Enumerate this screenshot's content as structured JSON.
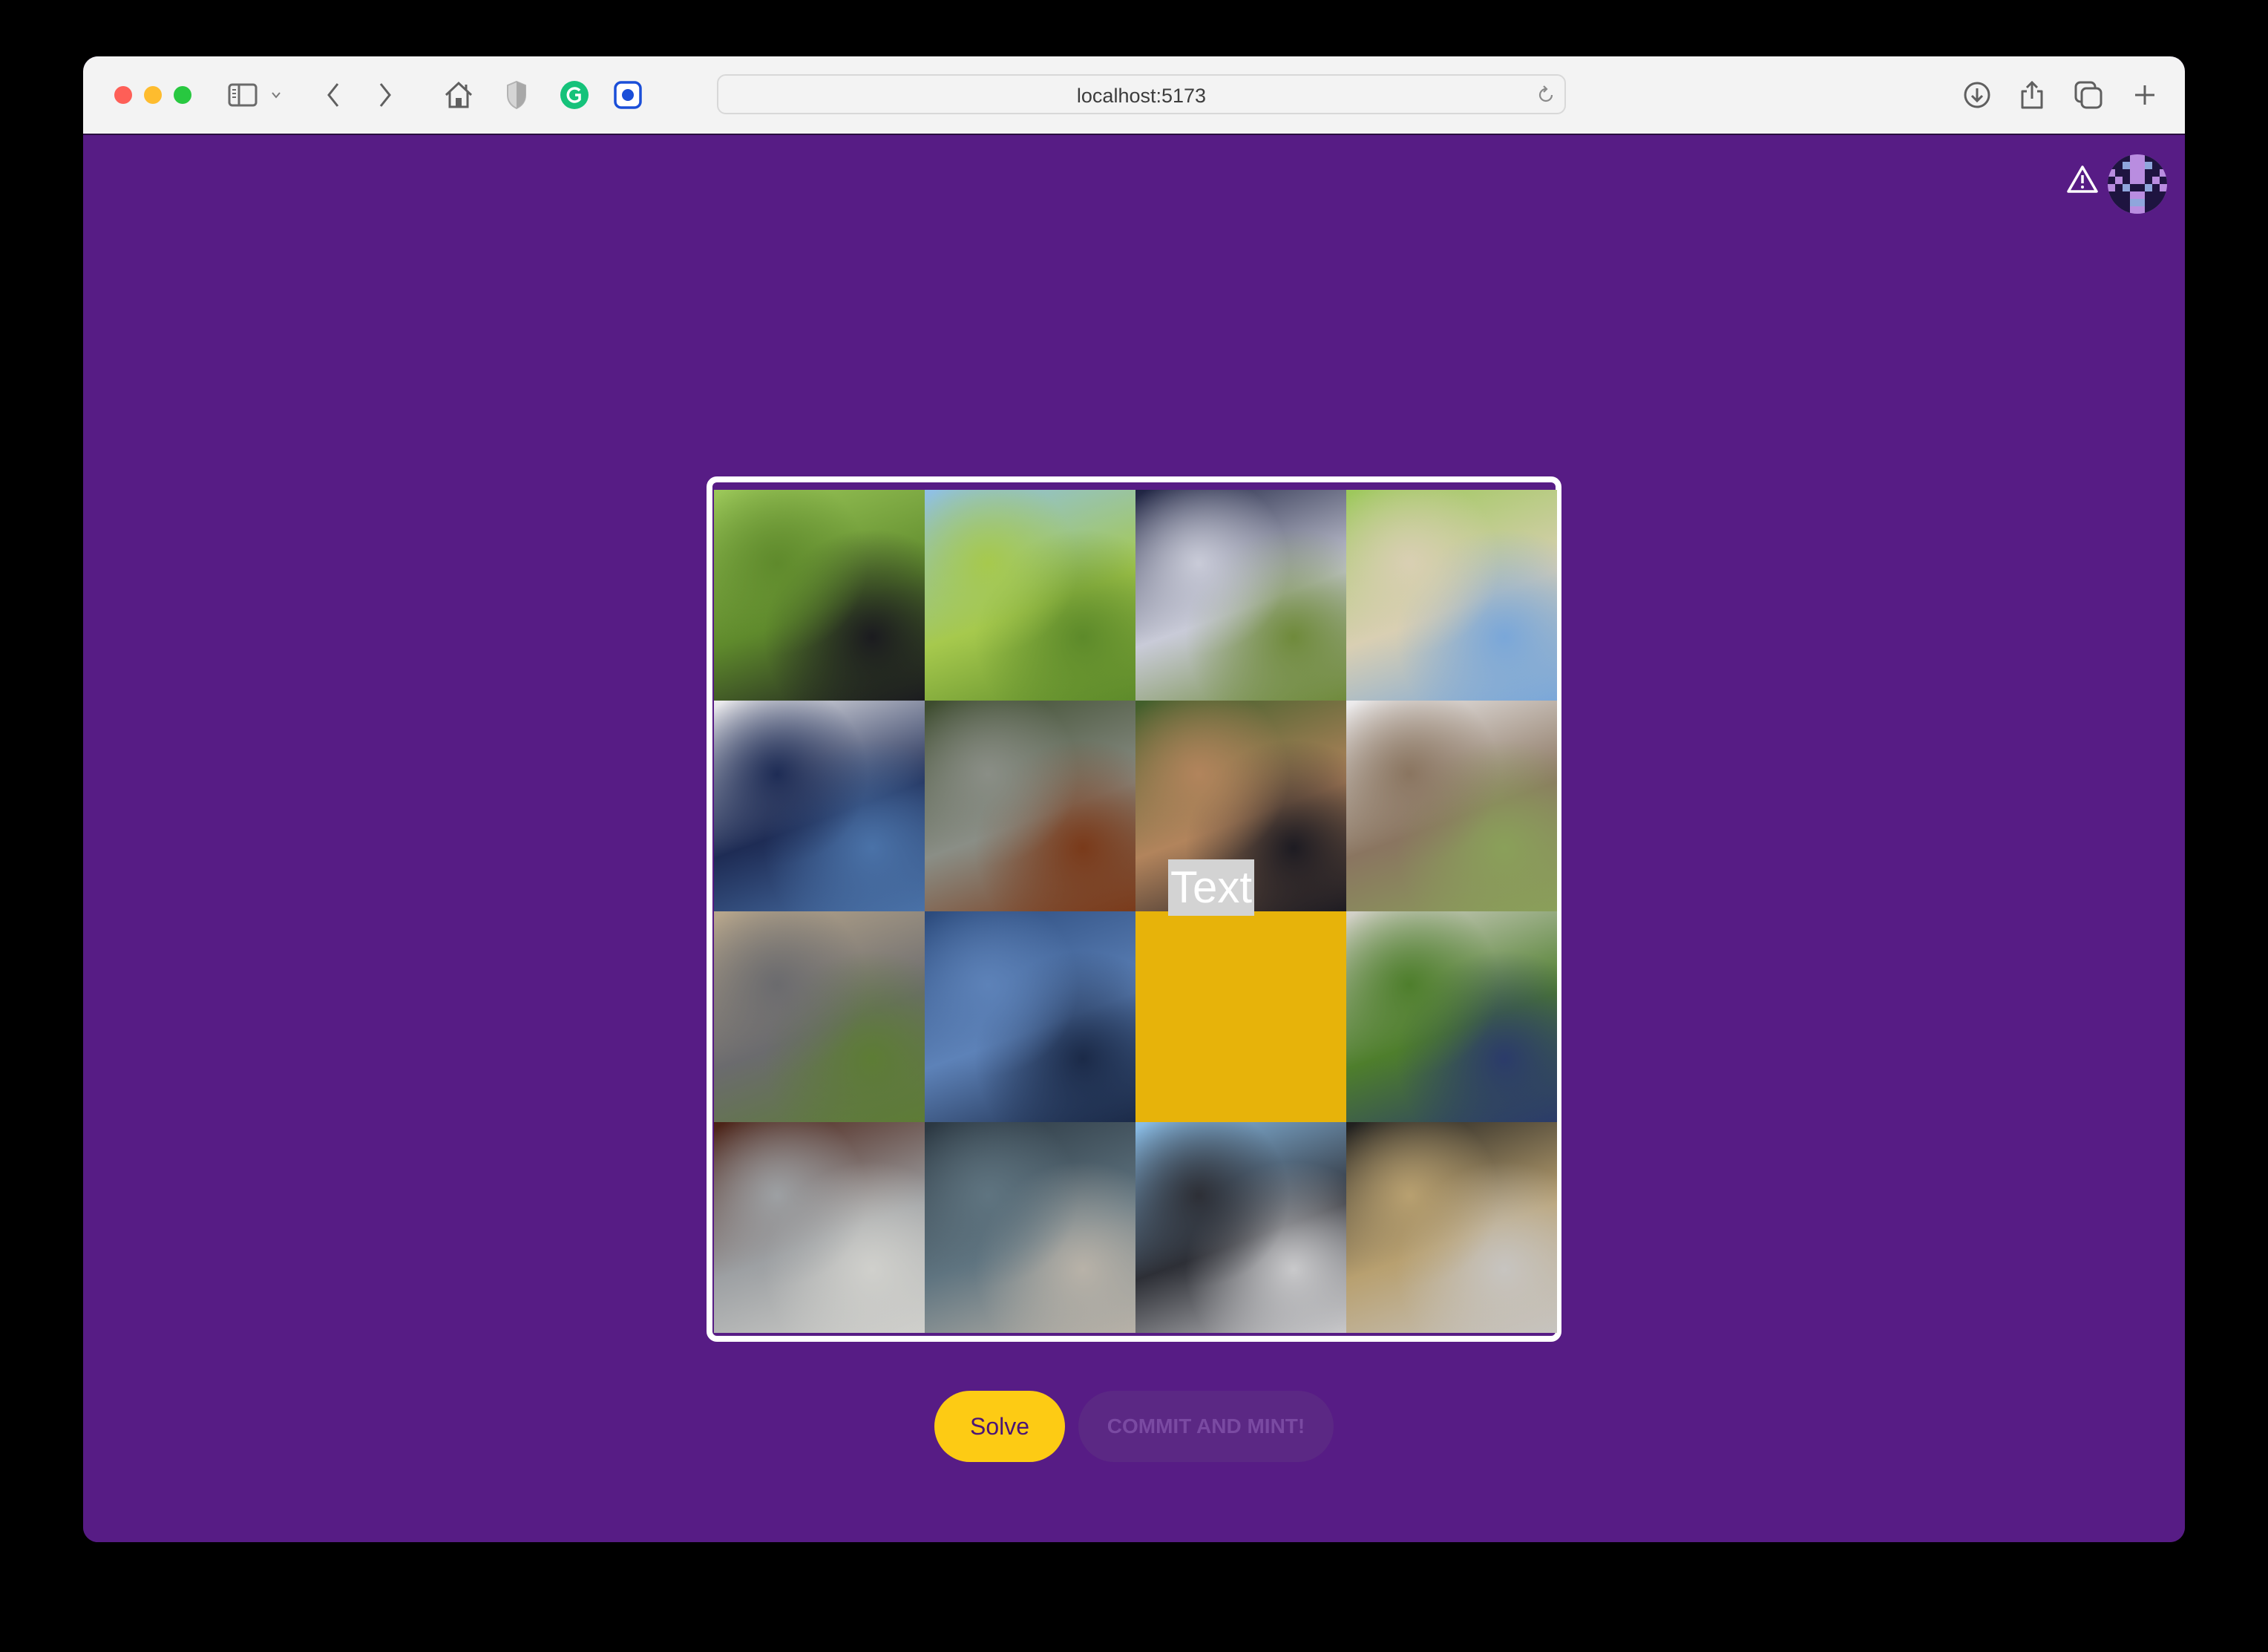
{
  "browser": {
    "url": "localhost:5173",
    "toolbar_icons": [
      "sidebar-icon",
      "chevron-down-icon",
      "back-icon",
      "forward-icon",
      "home-icon",
      "shield-icon",
      "grammarly-icon",
      "record-extension-icon",
      "reload-icon",
      "download-icon",
      "share-icon",
      "tabs-overview-icon",
      "new-tab-icon"
    ]
  },
  "header": {
    "warning_icon": "warning-triangle-icon",
    "avatar": "identicon-avatar"
  },
  "puzzle": {
    "grid_size": 4,
    "overlay_label": "Text",
    "empty_tile_color": "#e7b30a",
    "tiles": [
      {
        "row": 0,
        "col": 0,
        "desc": "trees and dark object, blurred face",
        "colors": [
          "#9cc85a",
          "#5f8a2c",
          "#1b1b1f"
        ]
      },
      {
        "row": 0,
        "col": 1,
        "desc": "trees against blue sky",
        "colors": [
          "#8fc0e8",
          "#a6c94d",
          "#5d8a2a"
        ]
      },
      {
        "row": 0,
        "col": 2,
        "desc": "person in dark t-shirt",
        "colors": [
          "#1c2140",
          "#c9cbd8",
          "#6f8a3b"
        ]
      },
      {
        "row": 0,
        "col": 3,
        "desc": "person with hood and trees",
        "colors": [
          "#9cc85a",
          "#d9cfb3",
          "#7aa7d9"
        ]
      },
      {
        "row": 1,
        "col": 0,
        "desc": "white top and jeans",
        "colors": [
          "#efeef0",
          "#1e2c55",
          "#4a72a8"
        ]
      },
      {
        "row": 1,
        "col": 1,
        "desc": "cafe window street scene",
        "colors": [
          "#3b4a2c",
          "#8a8e86",
          "#7a3a1a"
        ]
      },
      {
        "row": 1,
        "col": 2,
        "desc": "arm, planters and trees",
        "colors": [
          "#3f5e2a",
          "#b2845c",
          "#1d1b22"
        ]
      },
      {
        "row": 1,
        "col": 3,
        "desc": "blurred face, white t-shirt",
        "colors": [
          "#efeef0",
          "#8a7560",
          "#8aa05a"
        ]
      },
      {
        "row": 2,
        "col": 0,
        "desc": "umbrella and pole",
        "colors": [
          "#b9a88d",
          "#6b6b6e",
          "#5d7c35"
        ]
      },
      {
        "row": 2,
        "col": 1,
        "desc": "jeans legs",
        "colors": [
          "#2b4a7c",
          "#5d82b8",
          "#1b2a48"
        ]
      },
      {
        "row": 2,
        "col": 2,
        "desc": "empty slot",
        "colors": [
          "#e7b30a"
        ]
      },
      {
        "row": 2,
        "col": 3,
        "desc": "umbrella over greenery",
        "colors": [
          "#d6d3cc",
          "#4e7e2c",
          "#2b3b6a"
        ]
      },
      {
        "row": 3,
        "col": 0,
        "desc": "chair back and pole",
        "colors": [
          "#4a2014",
          "#9da0a3",
          "#d0d0cc"
        ]
      },
      {
        "row": 3,
        "col": 1,
        "desc": "dark trousers",
        "colors": [
          "#2a3640",
          "#5f7480",
          "#b8b2a8"
        ]
      },
      {
        "row": 3,
        "col": 2,
        "desc": "black object against sky",
        "colors": [
          "#8cc0ea",
          "#2d2f36",
          "#c9c9cb"
        ]
      },
      {
        "row": 3,
        "col": 3,
        "desc": "metal fence and plants",
        "colors": [
          "#1d1d1d",
          "#b8a070",
          "#c7c4c0"
        ]
      }
    ]
  },
  "actions": {
    "solve_label": "Solve",
    "commit_label": "COMMIT AND MINT!",
    "commit_enabled": false
  }
}
